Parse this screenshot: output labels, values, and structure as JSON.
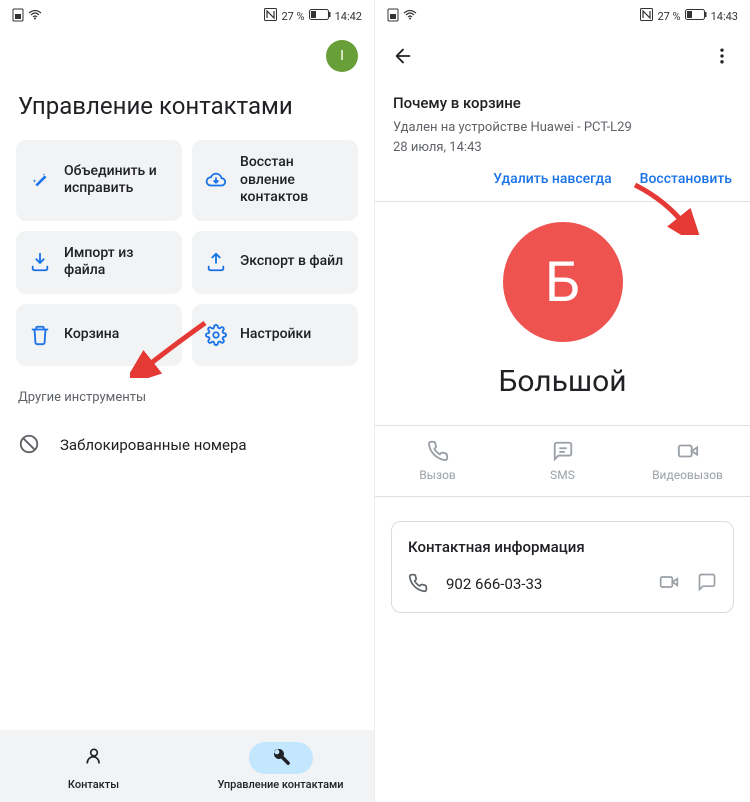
{
  "left": {
    "status": {
      "battery": "27 %",
      "time": "14:42"
    },
    "avatar_initial": "I",
    "title": "Управление контактами",
    "tiles": [
      {
        "label": "Объединить и исправить"
      },
      {
        "label": "Восстан овление контактов"
      },
      {
        "label": "Импорт из файла"
      },
      {
        "label": "Экспорт в файл"
      },
      {
        "label": "Корзина"
      },
      {
        "label": "Настройки"
      }
    ],
    "other_section": "Другие инструменты",
    "blocked": "Заблокированные номера",
    "nav": {
      "contacts": "Контакты",
      "manage": "Управление контактами"
    }
  },
  "right": {
    "status": {
      "battery": "27 %",
      "time": "14:43"
    },
    "trash": {
      "why": "Почему в корзине",
      "deleted_on": "Удален на устройстве Huawei - PCT-L29",
      "date": "28 июля, 14:43",
      "delete_forever": "Удалить навсегда",
      "restore": "Восстановить"
    },
    "contact": {
      "initial": "Б",
      "name": "Большой",
      "actions": {
        "call": "Вызов",
        "sms": "SMS",
        "video": "Видеовызов"
      },
      "info_title": "Контактная информация",
      "phone": "902 666-03-33"
    }
  }
}
